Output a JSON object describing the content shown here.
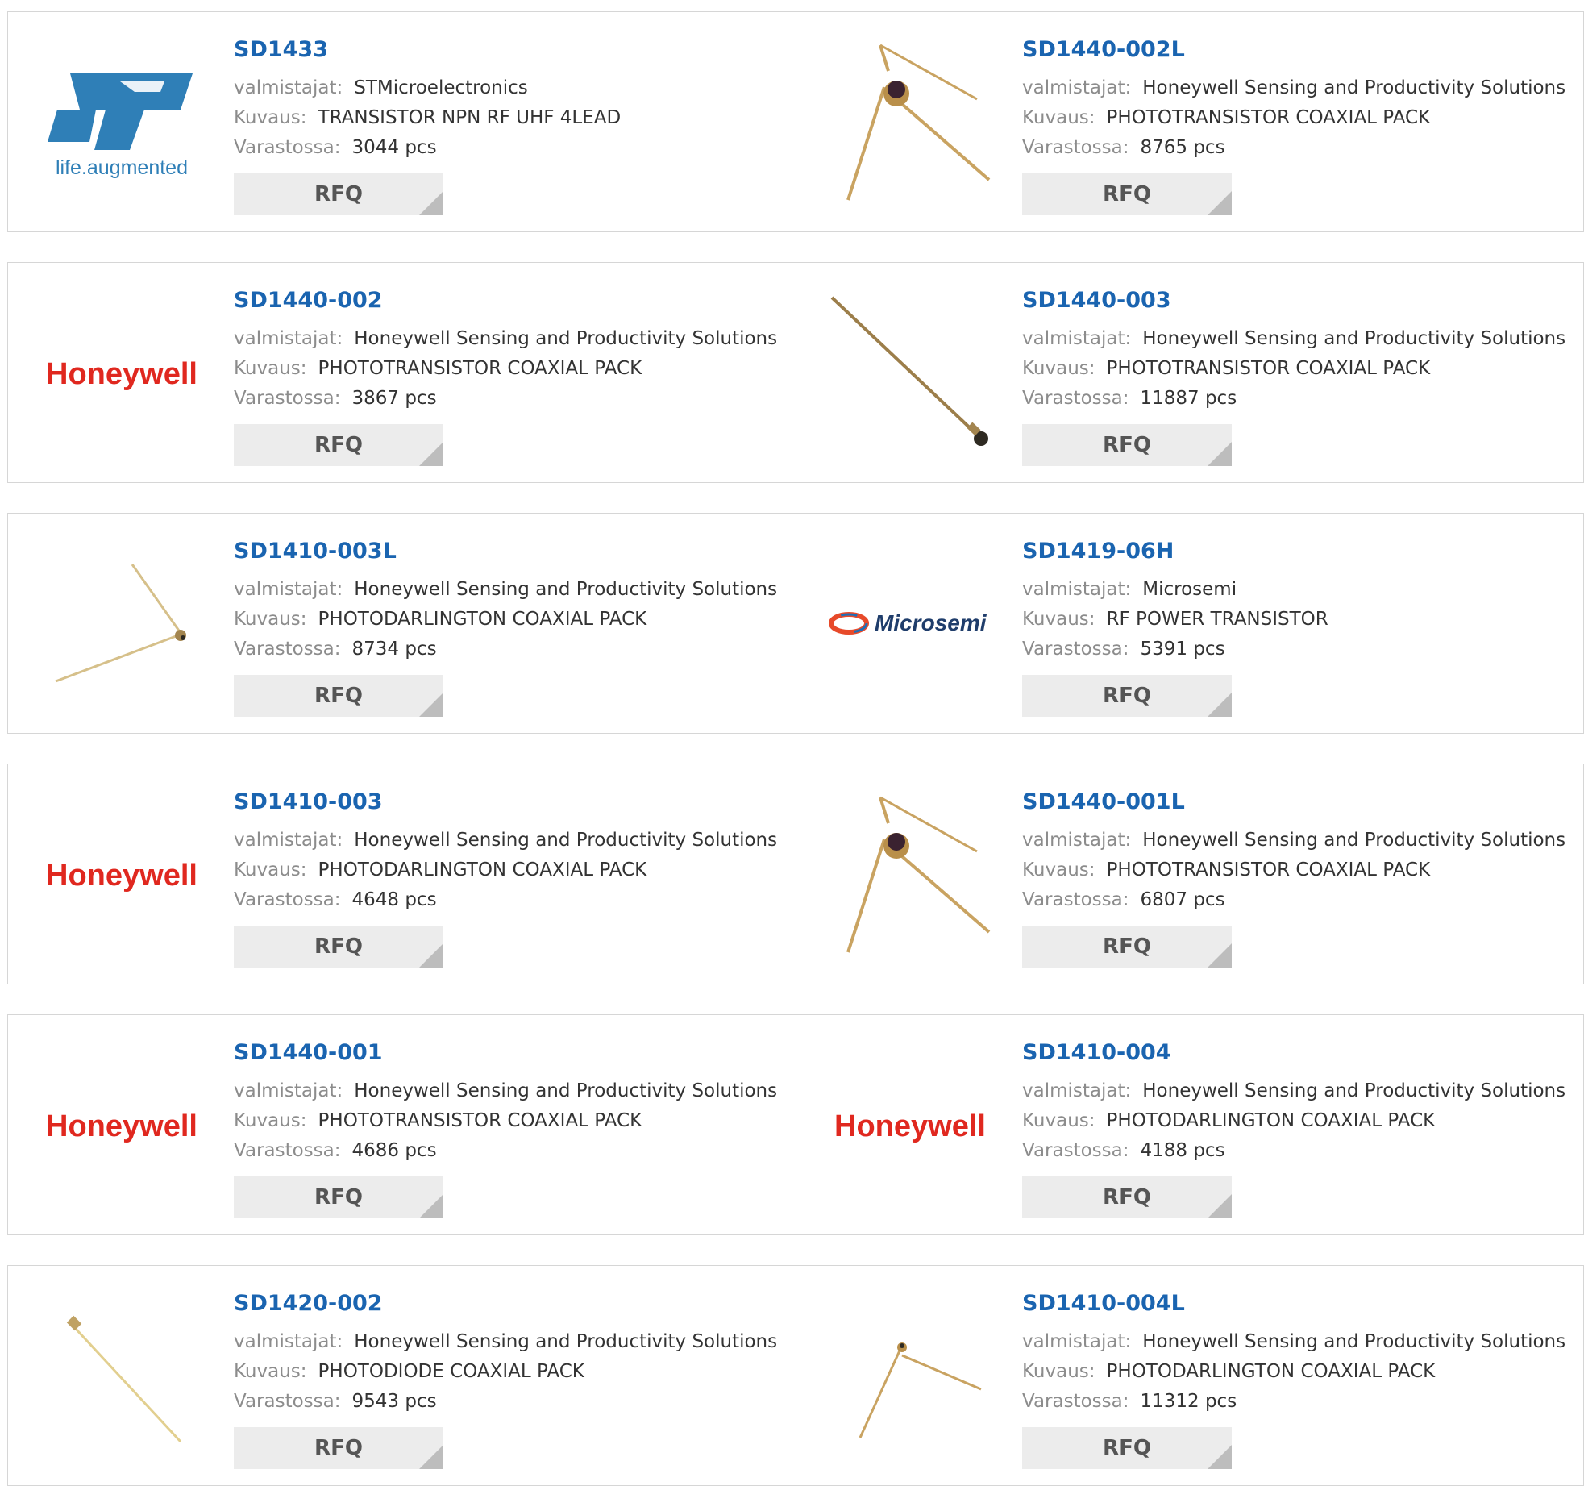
{
  "labels": {
    "manufacturer": "valmistajat:",
    "description": "Kuvaus:",
    "stock": "Varastossa:",
    "rfq": "RFQ"
  },
  "products": [
    {
      "part": "SD1433",
      "manufacturer": "STMicroelectronics",
      "description": "TRANSISTOR NPN RF UHF 4LEAD",
      "stock": "3044 pcs",
      "image": "st-logo",
      "logo_text": "life.augmented"
    },
    {
      "part": "SD1440-002L",
      "manufacturer": "Honeywell Sensing and Productivity Solutions",
      "description": "PHOTOTRANSISTOR COAXIAL PACK",
      "stock": "8765 pcs",
      "image": "coaxial-bent-photo"
    },
    {
      "part": "SD1440-002",
      "manufacturer": "Honeywell Sensing and Productivity Solutions",
      "description": "PHOTOTRANSISTOR COAXIAL PACK",
      "stock": "3867 pcs",
      "image": "honeywell-logo",
      "logo_text": "Honeywell"
    },
    {
      "part": "SD1440-003",
      "manufacturer": "Honeywell Sensing and Productivity Solutions",
      "description": "PHOTOTRANSISTOR COAXIAL PACK",
      "stock": "11887 pcs",
      "image": "coaxial-straight-photo"
    },
    {
      "part": "SD1410-003L",
      "manufacturer": "Honeywell Sensing and Productivity Solutions",
      "description": "PHOTODARLINGTON COAXIAL PACK",
      "stock": "8734 pcs",
      "image": "coaxial-angled-photo"
    },
    {
      "part": "SD1419-06H",
      "manufacturer": "Microsemi",
      "description": "RF POWER TRANSISTOR",
      "stock": "5391 pcs",
      "image": "microsemi-logo",
      "logo_text": "Microsemi"
    },
    {
      "part": "SD1410-003",
      "manufacturer": "Honeywell Sensing and Productivity Solutions",
      "description": "PHOTODARLINGTON COAXIAL PACK",
      "stock": "4648 pcs",
      "image": "honeywell-logo",
      "logo_text": "Honeywell"
    },
    {
      "part": "SD1440-001L",
      "manufacturer": "Honeywell Sensing and Productivity Solutions",
      "description": "PHOTOTRANSISTOR COAXIAL PACK",
      "stock": "6807 pcs",
      "image": "coaxial-bent-photo"
    },
    {
      "part": "SD1440-001",
      "manufacturer": "Honeywell Sensing and Productivity Solutions",
      "description": "PHOTOTRANSISTOR COAXIAL PACK",
      "stock": "4686 pcs",
      "image": "honeywell-logo",
      "logo_text": "Honeywell"
    },
    {
      "part": "SD1410-004",
      "manufacturer": "Honeywell Sensing and Productivity Solutions",
      "description": "PHOTODARLINGTON COAXIAL PACK",
      "stock": "4188 pcs",
      "image": "honeywell-logo",
      "logo_text": "Honeywell"
    },
    {
      "part": "SD1420-002",
      "manufacturer": "Honeywell Sensing and Productivity Solutions",
      "description": "PHOTODIODE COAXIAL PACK",
      "stock": "9543 pcs",
      "image": "coaxial-diagonal-photo"
    },
    {
      "part": "SD1410-004L",
      "manufacturer": "Honeywell Sensing and Productivity Solutions",
      "description": "PHOTODARLINGTON COAXIAL PACK",
      "stock": "11312 pcs",
      "image": "coaxial-thin-bent-photo"
    }
  ],
  "colors": {
    "link": "#1a64b0",
    "honeywell": "#e0281f",
    "st": "#2f7fb7",
    "rfq_bg": "#ececec",
    "border": "#d6d6d6"
  }
}
